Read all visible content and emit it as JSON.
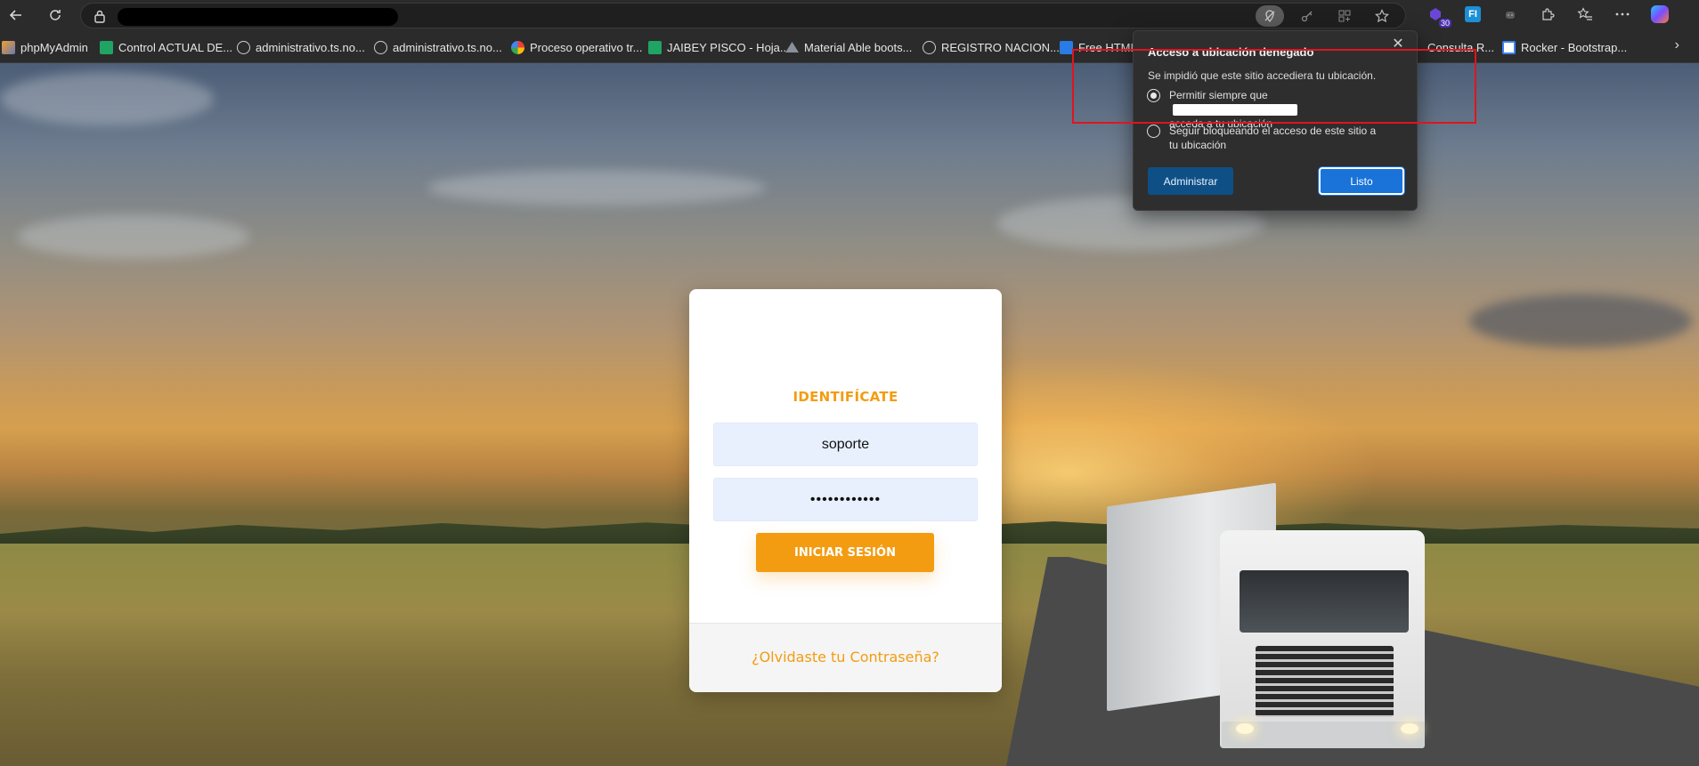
{
  "browser": {
    "address_bar": {
      "url_redacted": true
    },
    "extensions": {
      "badge_count": "30",
      "fi_label": "FI"
    }
  },
  "bookmarks": [
    {
      "label": "phpMyAdmin",
      "icon": "phpmyadmin-icon",
      "color": "#f0a030"
    },
    {
      "label": "Control ACTUAL DE...",
      "icon": "sheets-icon",
      "color": "#1fa463"
    },
    {
      "label": "administrativo.ts.no...",
      "icon": "globe-icon",
      "color": "#cccccc"
    },
    {
      "label": "administrativo.ts.no...",
      "icon": "globe-icon",
      "color": "#cccccc"
    },
    {
      "label": "Proceso operativo tr...",
      "icon": "google-icon",
      "color": "#f4b400"
    },
    {
      "label": "JAIBEY PISCO - Hoja...",
      "icon": "sheets-icon",
      "color": "#1fa463"
    },
    {
      "label": "Material Able boots...",
      "icon": "able-icon",
      "color": "#8a9099"
    },
    {
      "label": "REGISTRO NACION...",
      "icon": "globe-icon",
      "color": "#cccccc"
    },
    {
      "label": "Free HTML",
      "icon": "html-icon",
      "color": "#2a7be4"
    },
    {
      "label": "Consulta R...",
      "icon": "bookmark-icon",
      "color": "#cccccc"
    },
    {
      "label": "Rocker - Bootstrap...",
      "icon": "rocker-icon",
      "color": "#3b82f6"
    }
  ],
  "login": {
    "title": "IDENTIFÍCATE",
    "username_value": "soporte",
    "password_value": "••••••••••••",
    "submit_label": "INICIAR SESIÓN",
    "forgot_label": "¿Olvidaste tu Contraseña?"
  },
  "location_popup": {
    "title": "Acceso a ubicación denegado",
    "description": "Se impidió que este sitio accediera tu ubicación.",
    "option_allow_prefix": "Permitir siempre que",
    "option_allow_suffix": "acceda a tu ubicación",
    "option_block": "Seguir bloqueando el acceso de este sitio a tu ubicación",
    "selected_option": "allow",
    "manage_label": "Administrar",
    "done_label": "Listo"
  },
  "colors": {
    "accent_orange": "#f39c12",
    "popup_primary": "#1a73d9",
    "highlight_red": "#e0141e"
  }
}
